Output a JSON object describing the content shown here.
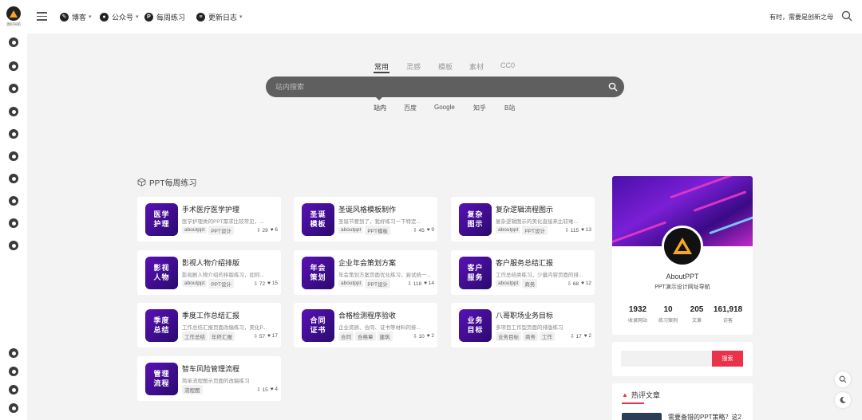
{
  "logo": {
    "text": "源码导航"
  },
  "header": {
    "nav": [
      {
        "label": "博客",
        "icon": "pen-icon",
        "has_dropdown": true
      },
      {
        "label": "公众号",
        "icon": "wechat-icon",
        "has_dropdown": true
      },
      {
        "label": "每周练习",
        "icon": "p-icon",
        "has_dropdown": false
      },
      {
        "label": "更新日志",
        "icon": "log-icon",
        "has_dropdown": true
      }
    ],
    "motto": "有时，需要是创新之母"
  },
  "search": {
    "tabs": [
      "常用",
      "灵感",
      "模板",
      "素材",
      "CC0"
    ],
    "active_tab": "常用",
    "placeholder": "站内搜索",
    "engines": [
      "站内",
      "百度",
      "Google",
      "知乎",
      "B站"
    ],
    "active_engine": "站内"
  },
  "section": {
    "title": "PPT每周练习"
  },
  "cards": [
    {
      "thumb": [
        "医学",
        "护理"
      ],
      "title": "手术医疗医学护理",
      "desc": "医学护理类的PPT需求比较常见，...",
      "tags": [
        "aboutppt",
        "PPT设计"
      ],
      "downloads": "29",
      "likes": "6"
    },
    {
      "thumb": [
        "圣诞",
        "模板"
      ],
      "title": "圣诞风格模板制作",
      "desc": "圣诞节要到了，我好练习一下特定...",
      "tags": [
        "aboutppt",
        "PPT模板"
      ],
      "downloads": "45",
      "likes": "9"
    },
    {
      "thumb": [
        "复杂",
        "图示"
      ],
      "title": "复杂逻辑流程图示",
      "desc": "复杂逻辑图示的美化直接来比较难...",
      "tags": [
        "aboutppt",
        "PPT设计"
      ],
      "downloads": "115",
      "likes": "13"
    },
    {
      "thumb": [
        "影视",
        "人物"
      ],
      "title": "影视人物介绍排版",
      "desc": "影视剧人物介绍的排版练习，如何...",
      "tags": [
        "aboutppt",
        "PPT设计"
      ],
      "downloads": "72",
      "likes": "15"
    },
    {
      "thumb": [
        "年会",
        "策划"
      ],
      "title": "企业年会策划方案",
      "desc": "年会策划方案页面优化练习，尝试统一...",
      "tags": [
        "aboutppt",
        "PPT设计"
      ],
      "downloads": "118",
      "likes": "14"
    },
    {
      "thumb": [
        "客户",
        "服务"
      ],
      "title": "客户服务总结汇报",
      "desc": "工作总结类练习，少量内容页面的排...",
      "tags": [
        "aboutppt",
        "商务"
      ],
      "downloads": "68",
      "likes": "12"
    },
    {
      "thumb": [
        "季度",
        "总结"
      ],
      "title": "季度工作总结汇报",
      "desc": "工作总结汇报页面改稿练习，美化P...",
      "tags": [
        "工作总结",
        "年终汇报"
      ],
      "downloads": "57",
      "likes": "17"
    },
    {
      "thumb": [
        "合同",
        "证书"
      ],
      "title": "合格检测程序验收",
      "desc": "企业资质、合同、证书等材料的排...",
      "tags": [
        "合同",
        "合格章",
        "建筑"
      ],
      "downloads": "10",
      "likes": "2"
    },
    {
      "thumb": [
        "业务",
        "目标"
      ],
      "title": "八哥职场业务目标",
      "desc": "多项目工作型页面的排版练习",
      "tags": [
        "业务目标",
        "商务",
        "工作"
      ],
      "downloads": "17",
      "likes": "2"
    },
    {
      "thumb": [
        "管理",
        "流程"
      ],
      "title": "智车风险管理流程",
      "desc": "简单流程图示页面的改稿练习",
      "tags": [
        "流程图"
      ],
      "downloads": "15",
      "likes": "4"
    }
  ],
  "profile": {
    "name": "AboutPPT",
    "subtitle": "PPT演示设计网址导航",
    "stats": [
      {
        "value": "1932",
        "label": "收录网站"
      },
      {
        "value": "10",
        "label": "练习案例"
      },
      {
        "value": "205",
        "label": "文章"
      },
      {
        "value": "161,918",
        "label": "访客"
      }
    ]
  },
  "site_search": {
    "button_label": "搜索"
  },
  "hot": {
    "title": "热评文章",
    "first_item": "需要备错的PPT策略？这2"
  },
  "colors": {
    "accent": "#e8334a",
    "thumb_purple": "#4a0fa8",
    "searchbar": "#5f5f5f"
  }
}
